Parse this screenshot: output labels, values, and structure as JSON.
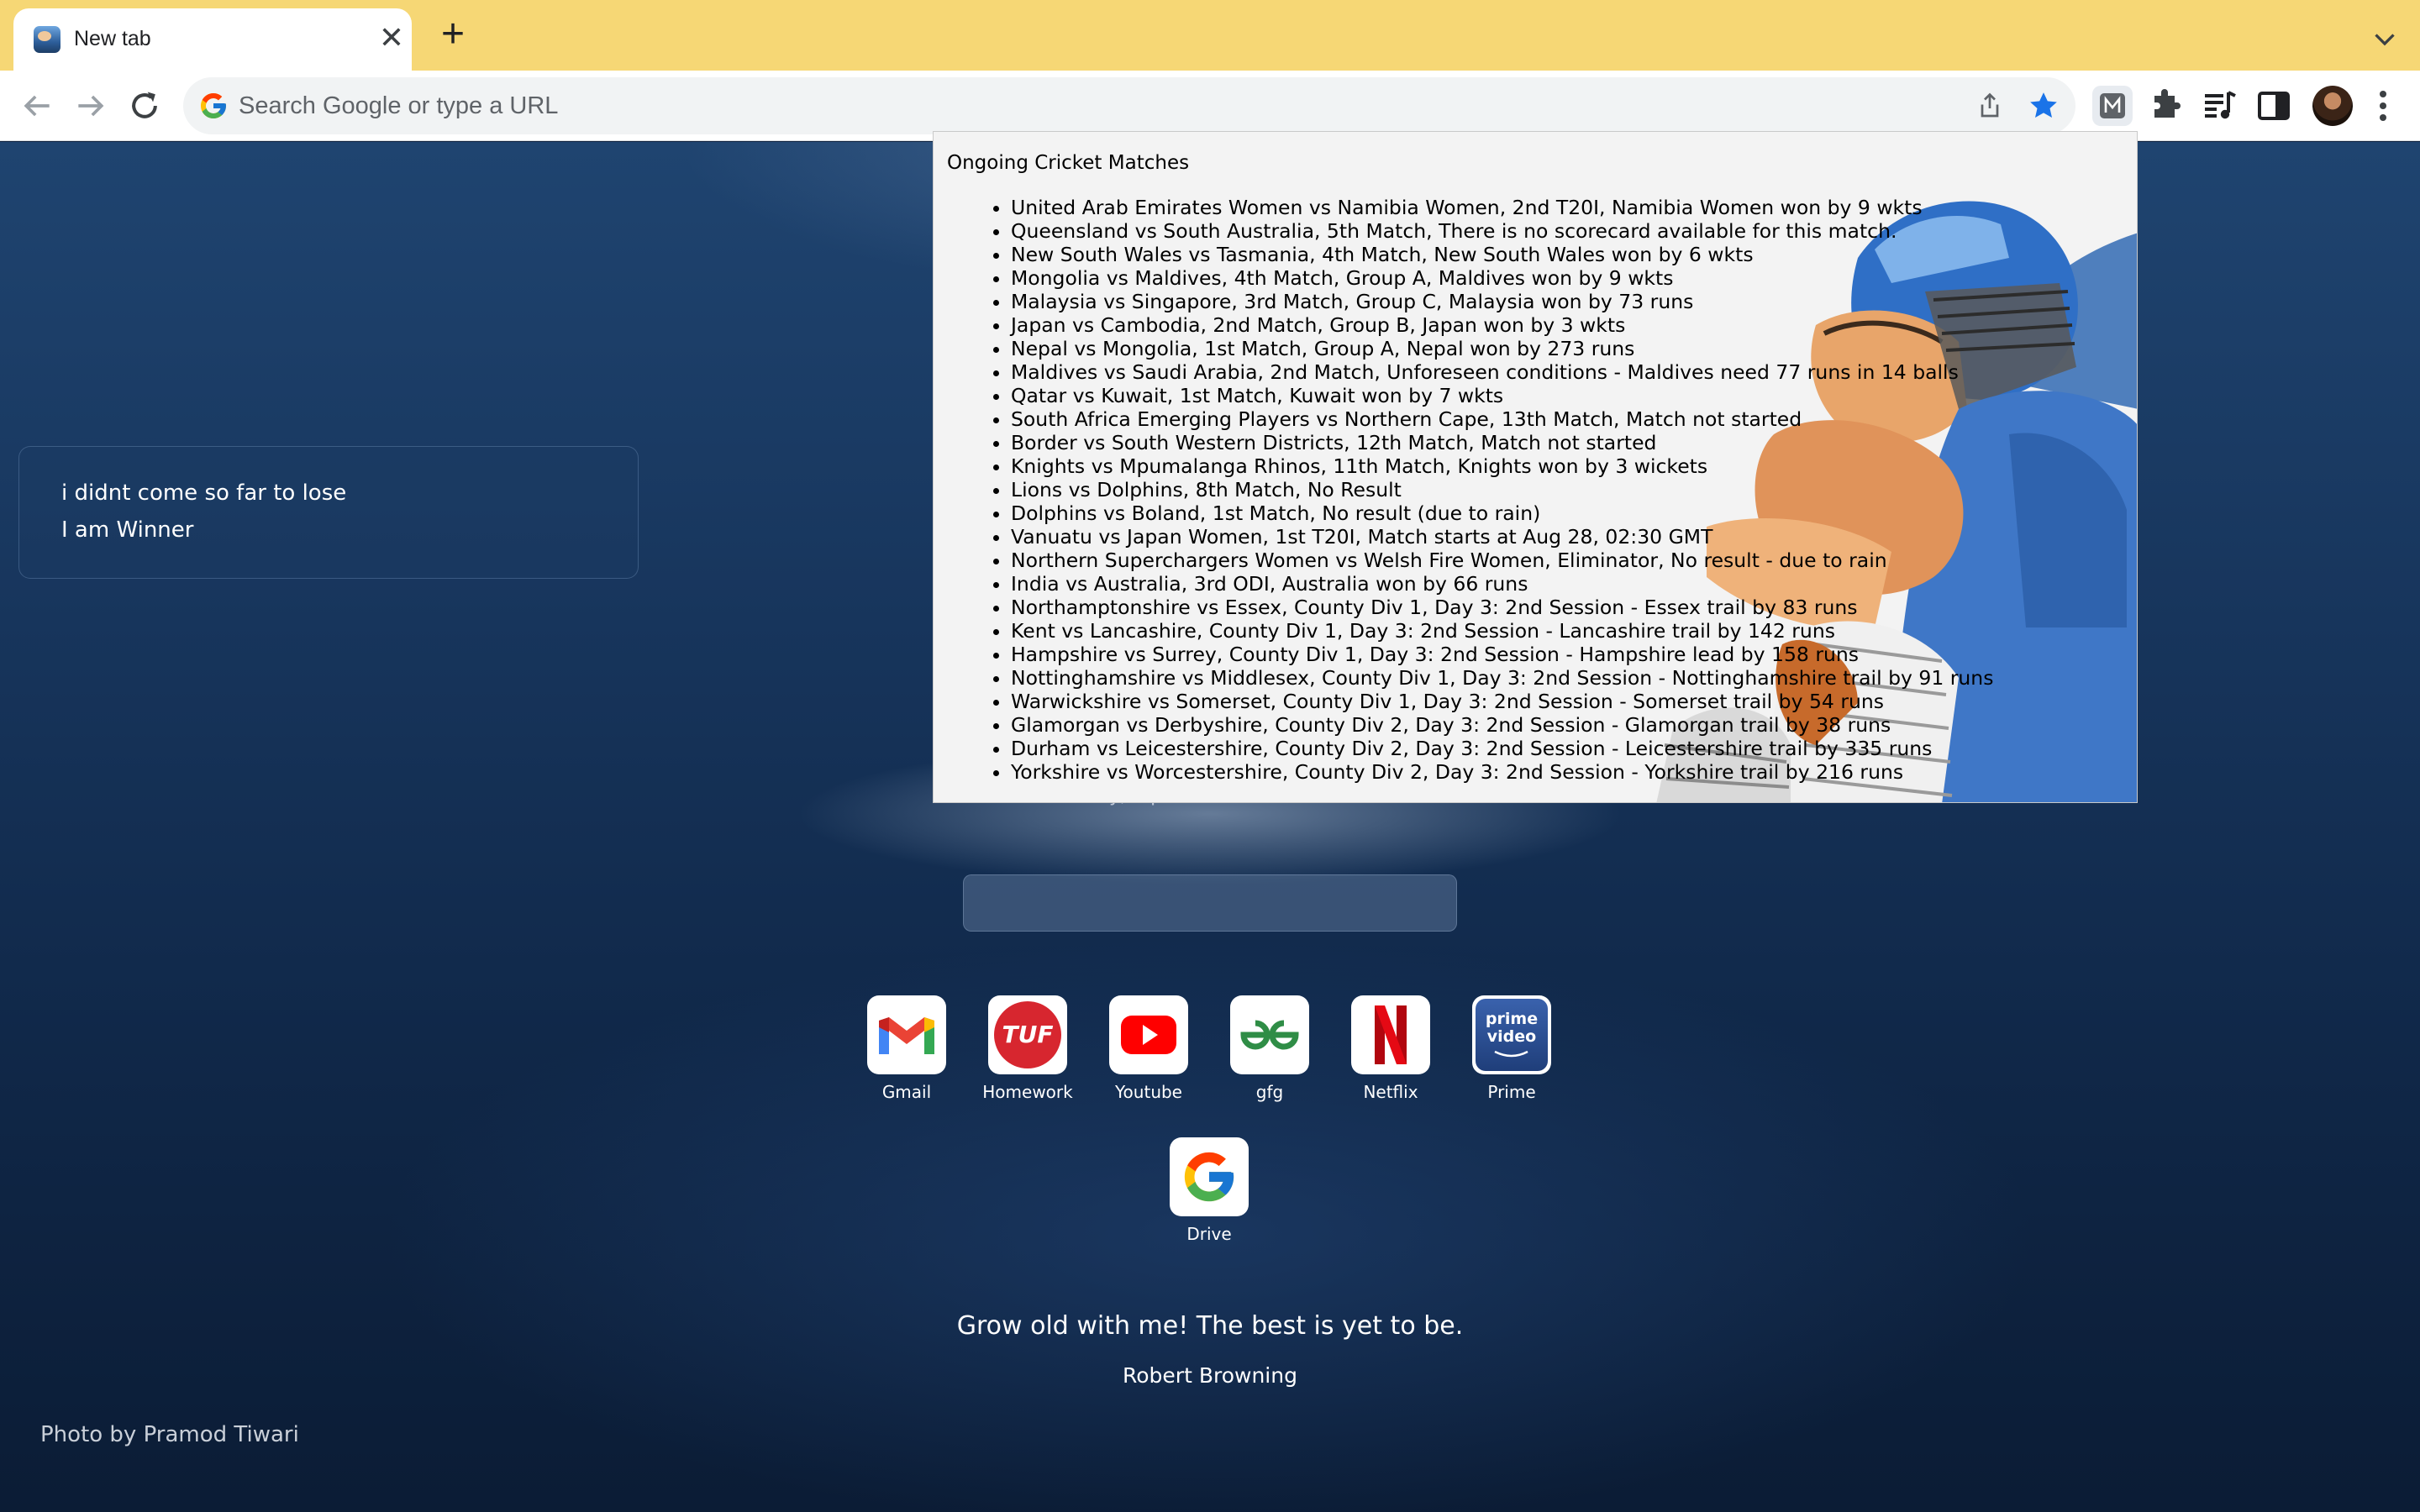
{
  "tab": {
    "title": "New tab",
    "close_glyph": "✕",
    "new_glyph": "+"
  },
  "omnibox": {
    "placeholder": "Search Google or type a URL"
  },
  "toolbar": {
    "extension_letter": "M"
  },
  "todo": {
    "items": [
      "i didnt come so far to lose",
      "I am Winner"
    ]
  },
  "hidden_under_popup": "y, repl",
  "shortcuts": [
    {
      "label": "Gmail",
      "icon": "gmail-icon"
    },
    {
      "label": "Homework",
      "icon": "tuf-icon",
      "tile_text": "TUF"
    },
    {
      "label": "Youtube",
      "icon": "youtube-icon"
    },
    {
      "label": "gfg",
      "icon": "gfg-icon"
    },
    {
      "label": "Netflix",
      "icon": "netflix-icon"
    },
    {
      "label": "Prime",
      "icon": "prime-video-icon",
      "tile_text": "prime video"
    },
    {
      "label": "Drive",
      "icon": "google-g-icon"
    }
  ],
  "quote": {
    "text": "Grow old with me! The best is yet to be.",
    "author": "Robert Browning"
  },
  "photo_credit": "Photo by Pramod Tiwari",
  "popup": {
    "title": "Ongoing Cricket Matches",
    "matches": [
      "United Arab Emirates Women vs Namibia Women, 2nd T20I, Namibia Women won by 9 wkts",
      "Queensland vs South Australia, 5th Match, There is no scorecard available for this match.",
      "New South Wales vs Tasmania, 4th Match, New South Wales won by 6 wkts",
      "Mongolia vs Maldives, 4th Match, Group A, Maldives won by 9 wkts",
      "Malaysia vs Singapore, 3rd Match, Group C, Malaysia won by 73 runs",
      "Japan vs Cambodia, 2nd Match, Group B, Japan won by 3 wkts",
      "Nepal vs Mongolia, 1st Match, Group A, Nepal won by 273 runs",
      "Maldives vs Saudi Arabia, 2nd Match, Unforeseen conditions - Maldives need 77 runs in 14 balls",
      "Qatar vs Kuwait, 1st Match, Kuwait won by 7 wkts",
      "South Africa Emerging Players vs Northern Cape, 13th Match, Match not started",
      "Border vs South Western Districts, 12th Match, Match not started",
      "Knights vs Mpumalanga Rhinos, 11th Match, Knights won by 3 wickets",
      "Lions vs Dolphins, 8th Match, No Result",
      "Dolphins vs Boland, 1st Match, No result (due to rain)",
      "Vanuatu vs Japan Women, 1st T20I, Match starts at Aug 28, 02:30 GMT",
      "Northern Superchargers Women vs Welsh Fire Women, Eliminator, No result - due to rain",
      "India vs Australia, 3rd ODI, Australia won by 66 runs",
      "Northamptonshire vs Essex, County Div 1, Day 3: 2nd Session - Essex trail by 83 runs",
      "Kent vs Lancashire, County Div 1, Day 3: 2nd Session - Lancashire trail by 142 runs",
      "Hampshire vs Surrey, County Div 1, Day 3: 2nd Session - Hampshire lead by 158 runs",
      "Nottinghamshire vs Middlesex, County Div 1, Day 3: 2nd Session - Nottinghamshire trail by 91 runs",
      "Warwickshire vs Somerset, County Div 1, Day 3: 2nd Session - Somerset trail by 54 runs",
      "Glamorgan vs Derbyshire, County Div 2, Day 3: 2nd Session - Glamorgan trail by 38 runs",
      "Durham vs Leicestershire, County Div 2, Day 3: 2nd Session - Leicestershire trail by 335 runs",
      "Yorkshire vs Worcestershire, County Div 2, Day 3: 2nd Session - Yorkshire trail by 216 runs"
    ]
  },
  "colors": {
    "tabstrip": "#f6d775",
    "star": "#1a73e8",
    "netflix": "#e50914",
    "youtube": "#ff0000",
    "gfg": "#2f8d46",
    "tuf": "#d7262f",
    "prime": "#2a4a8a"
  }
}
